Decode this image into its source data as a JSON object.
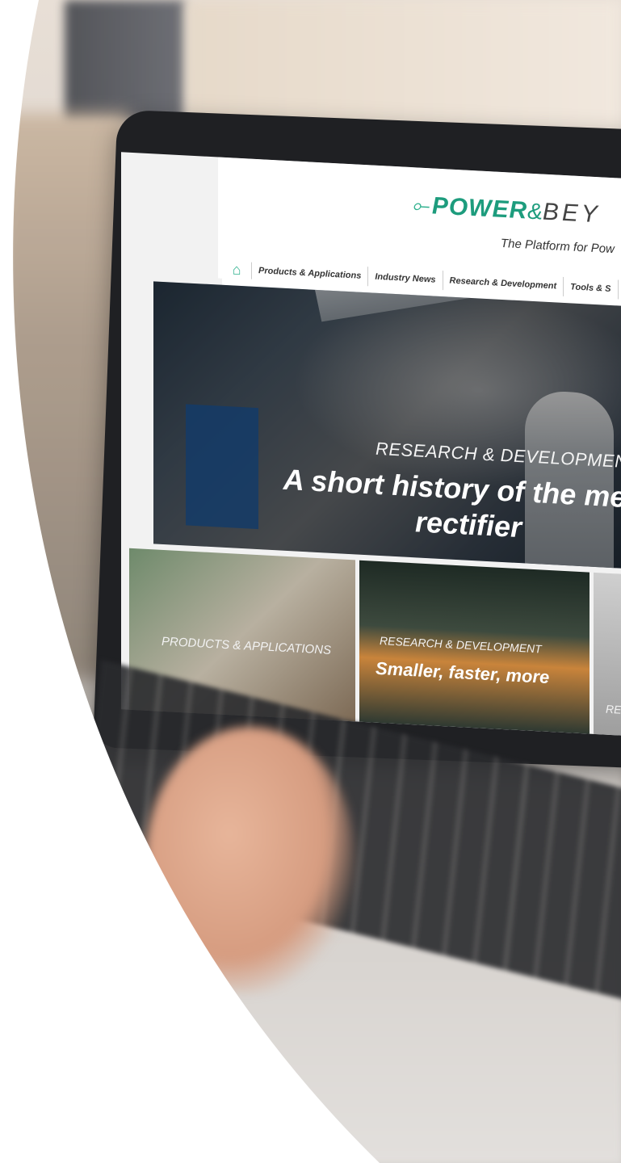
{
  "site": {
    "logo_power": "POWER",
    "logo_amp": "&",
    "logo_beyond": "BEY",
    "tagline": "The Platform for Pow"
  },
  "nav": {
    "items": [
      {
        "label": "Products & Applications"
      },
      {
        "label": "Industry News"
      },
      {
        "label": "Research & Development"
      },
      {
        "label": "Tools & S"
      }
    ]
  },
  "hero": {
    "category": "RESEARCH & DEVELOPMENT",
    "title_line1": "A short history of the merc",
    "title_line2": "rectifier"
  },
  "cards": [
    {
      "category": "PRODUCTS & APPLICATIONS"
    },
    {
      "category": "RESEARCH & DEVELOPMENT",
      "title": "Smaller, faster, more"
    },
    {
      "category": "RES"
    }
  ],
  "colors": {
    "brand_green": "#1d9c7d",
    "screen_bg": "#f2f2f2"
  }
}
